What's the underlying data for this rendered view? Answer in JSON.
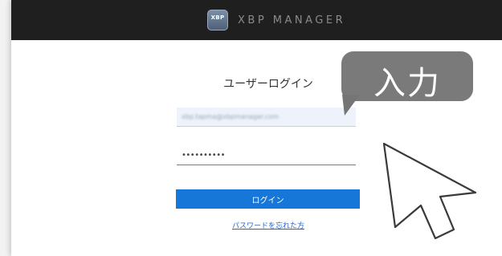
{
  "header": {
    "logo_text": "XBP",
    "brand_name": "XBP MANAGER"
  },
  "login": {
    "title": "ユーザーログイン",
    "email_value": "xbp.tapma@xbpmanager.com",
    "password_value": "••••••••••",
    "login_button": "ログイン",
    "forgot_password_link": "パスワードを忘れた方"
  },
  "annotation": {
    "bubble_text": "入力",
    "cursor_icon": "mouse-pointer-icon"
  },
  "colors": {
    "header_bg": "#1f1f1f",
    "button_blue": "#1677d8",
    "link_blue": "#2a64c4",
    "bubble_gray": "#757575"
  }
}
